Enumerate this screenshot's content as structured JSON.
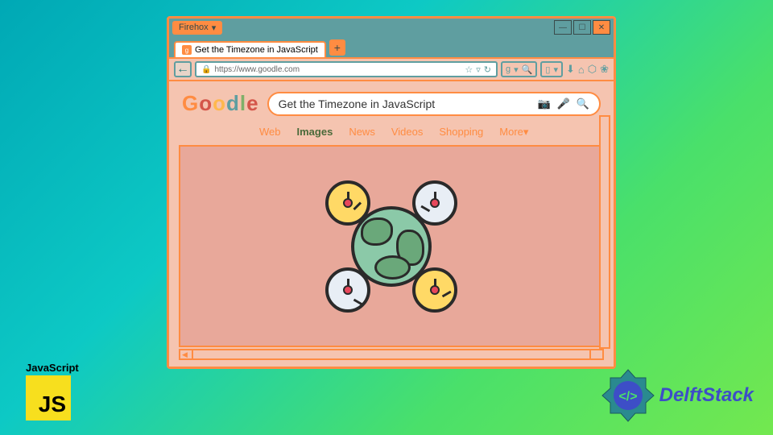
{
  "window": {
    "app_name": "Firehox",
    "tab_title": "Get the Timezone in JavaScript",
    "url": "https://www.goodle.com"
  },
  "page": {
    "logo_chars": [
      "G",
      "o",
      "o",
      "d",
      "l",
      "e"
    ],
    "search_query": "Get the Timezone in JavaScript",
    "nav": [
      {
        "label": "Web",
        "active": false
      },
      {
        "label": "Images",
        "active": true
      },
      {
        "label": "News",
        "active": false
      },
      {
        "label": "Videos",
        "active": false
      },
      {
        "label": "Shopping",
        "active": false
      },
      {
        "label": "More",
        "active": false,
        "dropdown": true
      }
    ]
  },
  "badges": {
    "js_label": "JavaScript",
    "js_logo_text": "JS",
    "delft_label": "DelftStack"
  }
}
